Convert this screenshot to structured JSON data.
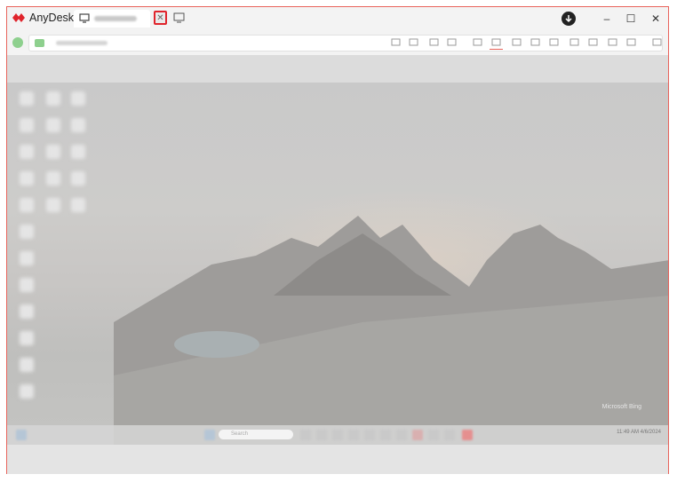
{
  "app": {
    "name": "AnyDesk"
  },
  "tab": {
    "close_glyph": "✕"
  },
  "window": {
    "minimize": "–",
    "maximize": "☐",
    "close": "✕"
  },
  "remote": {
    "watermark": "Microsoft Bing",
    "search_placeholder": "Search",
    "tray_time": "11:49 AM",
    "tray_date": "4/6/2024"
  },
  "colors": {
    "brand": "#e0242c",
    "accent": "#e8635b",
    "status_ok": "#8ed08e"
  },
  "toolbar_icons": [
    "chat-icon",
    "hourglass-icon",
    "database-icon",
    "star-icon",
    "file-icon",
    "monitor-icon",
    "screen-icon",
    "message-icon",
    "lightning-icon",
    "keyboard-icon",
    "shield-icon",
    "record-icon",
    "pen-icon",
    "menu-icon"
  ]
}
